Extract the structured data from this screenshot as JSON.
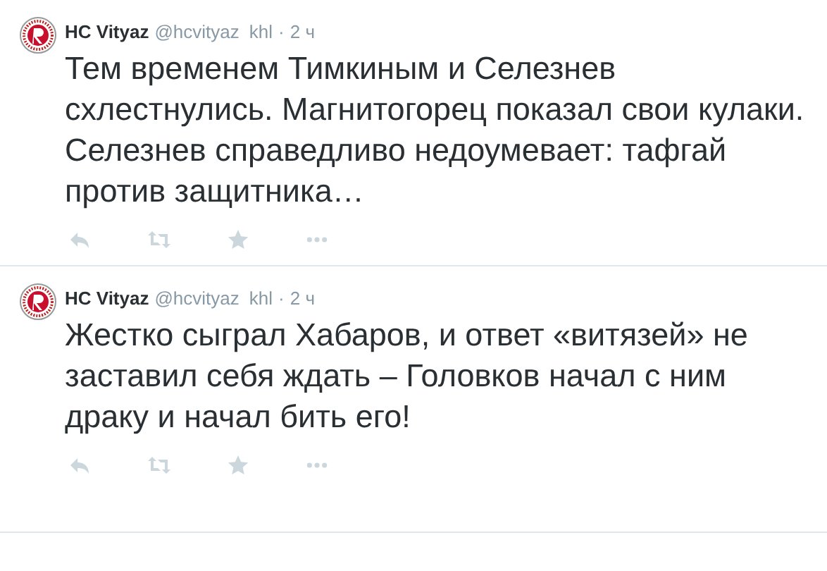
{
  "tweets": [
    {
      "name": "HC Vityaz",
      "handle": "@hcvityaz",
      "via": "khl",
      "separator": "·",
      "time": "2 ч",
      "text": "Тем временем Тимкиным и Селезнев схлестнулись. Магнитогорец показал свои кулаки. Селезнев справедливо недоумевает: тафгай против защитника…"
    },
    {
      "name": "HC Vityaz",
      "handle": "@hcvityaz",
      "via": "khl",
      "separator": "·",
      "time": "2 ч",
      "text": "Жестко сыграл Хабаров, и ответ «витязей» не заставил себя ждать – Головков начал с ним драку и начал бить его!"
    }
  ]
}
